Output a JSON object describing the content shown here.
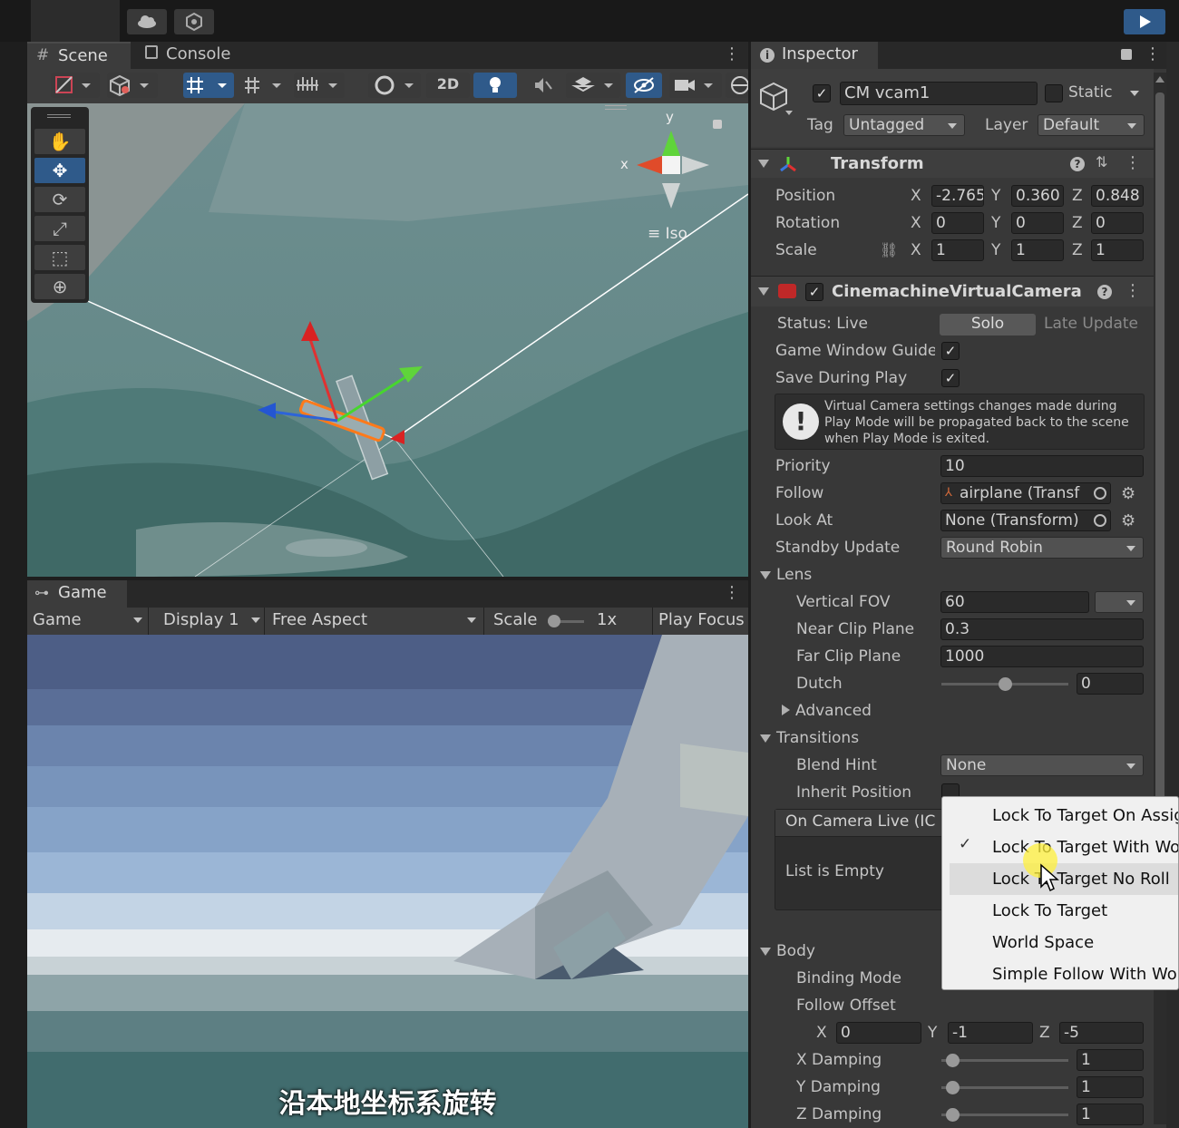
{
  "colors": {
    "accent": "#2f5a8a",
    "bg": "#282828",
    "header": "#3c3c3c",
    "sky": "#7da0c8",
    "ground": "#3f6b6e"
  },
  "toolbar_top": {
    "play_icon": "play-icon"
  },
  "scene_tabs": {
    "scene_label": "Scene",
    "console_label": "Console"
  },
  "scene_toolbar": {
    "twod_label": "2D"
  },
  "gizmo": {
    "y_label": "y",
    "x_label": "x",
    "iso_label": "Iso"
  },
  "game": {
    "tab_label": "Game",
    "mode_dropdown": "Game",
    "display_dropdown": "Display 1",
    "aspect_dropdown": "Free Aspect",
    "scale_label": "Scale",
    "scale_value": "1x",
    "play_focus_label": "Play Focus",
    "caption": "沿本地坐标系旋转"
  },
  "inspector": {
    "tab_label": "Inspector",
    "object_name": "CM vcam1",
    "static_label": "Static",
    "tag_label": "Tag",
    "tag_value": "Untagged",
    "layer_label": "Layer",
    "layer_value": "Default",
    "transform": {
      "title": "Transform",
      "position_label": "Position",
      "rotation_label": "Rotation",
      "scale_label": "Scale",
      "x": "X",
      "y": "Y",
      "z": "Z",
      "position": [
        "-2.765",
        "0.360",
        "0.848"
      ],
      "rotation": [
        "0",
        "0",
        "0"
      ],
      "scale": [
        "1",
        "1",
        "1"
      ]
    },
    "cvc": {
      "title": "CinemachineVirtualCamera",
      "status_label": "Status: Live",
      "solo_label": "Solo",
      "late_update_label": "Late Update",
      "game_window_guides_label": "Game Window Guide",
      "save_during_play_label": "Save During Play",
      "warning_text": "Virtual Camera settings changes made during Play Mode will be propagated back to the scene when Play Mode is exited.",
      "priority_label": "Priority",
      "priority_value": "10",
      "follow_label": "Follow",
      "follow_value": "airplane (Transf",
      "look_at_label": "Look At",
      "look_at_value": "None (Transform)",
      "standby_label": "Standby Update",
      "standby_value": "Round Robin",
      "lens_label": "Lens",
      "vfov_label": "Vertical FOV",
      "vfov_value": "60",
      "near_label": "Near Clip Plane",
      "near_value": "0.3",
      "far_label": "Far Clip Plane",
      "far_value": "1000",
      "dutch_label": "Dutch",
      "dutch_value": "0",
      "advanced_label": "Advanced",
      "transitions_label": "Transitions",
      "blend_hint_label": "Blend Hint",
      "blend_hint_value": "None",
      "inherit_label": "Inherit Position",
      "on_camera_live_label": "On Camera Live (IC",
      "list_empty_label": "List is Empty",
      "body_label": "Body",
      "binding_mode_label": "Binding Mode",
      "follow_offset_label": "Follow Offset",
      "follow_offset": [
        "0",
        "-1",
        "-5"
      ],
      "x_damping_label": "X Damping",
      "x_damping_value": "1",
      "y_damping_label": "Y Damping",
      "y_damping_value": "1",
      "z_damping_label": "Z Damping",
      "z_damping_value": "1"
    }
  },
  "binding_menu": {
    "items": [
      "Lock To Target On Assig",
      "Lock To Target With Wo",
      "Lock To Target No Roll",
      "Lock To Target",
      "World Space",
      "Simple Follow With Wor"
    ],
    "checked_index": 1,
    "hover_index": 2
  }
}
